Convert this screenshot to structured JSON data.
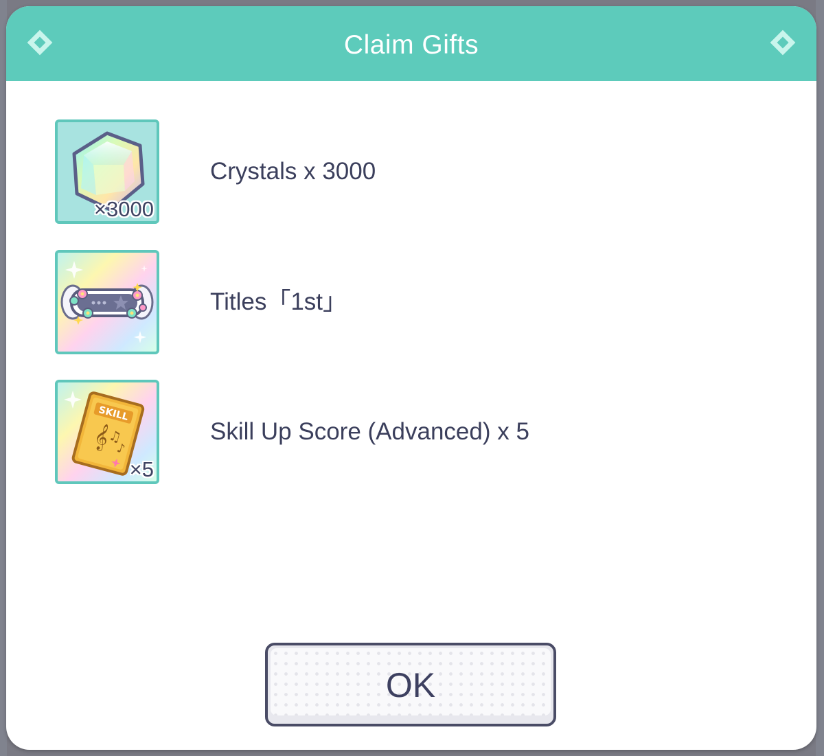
{
  "dialog": {
    "title": "Claim Gifts"
  },
  "gifts": [
    {
      "label": "Crystals x 3000",
      "icon": "crystal-icon",
      "count": "×3000"
    },
    {
      "label": "Titles「1st」",
      "icon": "title-plate-icon",
      "count": ""
    },
    {
      "label": "Skill Up Score (Advanced) x 5",
      "icon": "skill-score-book-icon",
      "count": "×5",
      "badge_text": "SKILL"
    }
  ],
  "ok_button": {
    "label": "OK"
  },
  "colors": {
    "header": "#5dcbbb",
    "text": "#3b3f5c",
    "icon_border": "#5fc7bb",
    "button_border": "#4a4c66"
  }
}
